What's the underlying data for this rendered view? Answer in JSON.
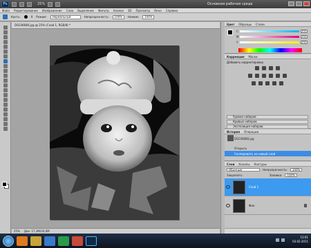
{
  "app": {
    "logo": "Ps",
    "zoom": "25%",
    "workspace": "Основная рабочая среда"
  },
  "menu": [
    "Файл",
    "Редактирование",
    "Изображение",
    "Слои",
    "Выделение",
    "Фильтр",
    "Анализ",
    "3D",
    "Просмотр",
    "Окно",
    "Справка"
  ],
  "options": {
    "brush_label": "Кисть:",
    "brush_size": "9",
    "mode_label": "Режим:",
    "mode_value": "Нормальный",
    "opacity_label": "Непрозрачность:",
    "opacity_value": "100%",
    "pressure_label": "Нажим:",
    "pressure_value": "100%"
  },
  "document": {
    "tab": "DSC06686.jpg @ 25% (Слой 1, RGB/8) *",
    "zoom": "25%",
    "status": "Док: 17,3M/34,6M"
  },
  "panels": {
    "color": {
      "tabs": [
        "Цвет",
        "Образцы",
        "Стили"
      ],
      "c_label": "C",
      "c_value": "255",
      "m_label": "M",
      "m_value": "255",
      "y_label": "Y",
      "y_value": "255"
    },
    "adjustments": {
      "tabs": [
        "Коррекция",
        "Маски"
      ],
      "title": "Добавить корректировку",
      "presets": [
        "Уровни наборов",
        "Кривые наборов",
        "Экспозиция наборов"
      ]
    },
    "history": {
      "tabs": [
        "История",
        "Операции"
      ],
      "snapshot": "DSC06686.jpg",
      "items": [
        "Открыть",
        "Скопировать на новый слой"
      ]
    },
    "layers": {
      "tabs": [
        "Слои",
        "Каналы",
        "Контуры"
      ],
      "mode": "Обычные",
      "opacity_label": "Непрозрачность:",
      "opacity_value": "100%",
      "lock_label": "Закрепить:",
      "fill_label": "Заливка:",
      "fill_value": "100%",
      "items": [
        {
          "name": "Слой 1"
        },
        {
          "name": "Фон"
        }
      ]
    }
  },
  "taskbar": {
    "time": "13:01",
    "date": "03.02.2011"
  },
  "colors": {
    "selection": "#3c9af0",
    "history_selection": "#3c8ce6"
  }
}
